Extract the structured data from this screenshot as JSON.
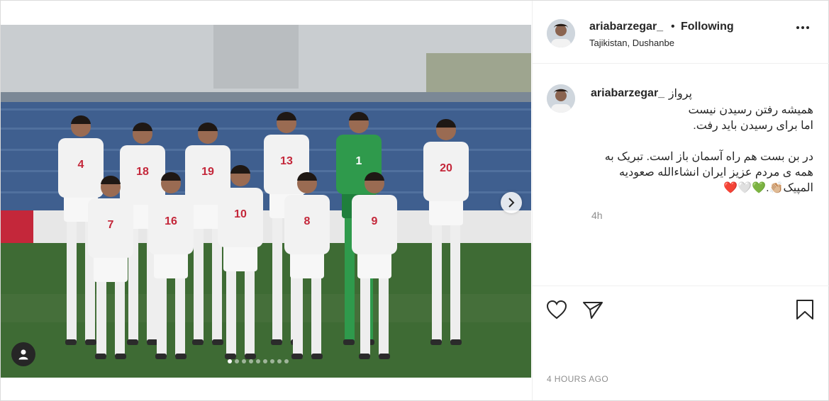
{
  "post": {
    "username": "ariabarzegar_",
    "separator": "•",
    "follow_label": "Following",
    "location": "Tajikistan, Dushanbe",
    "more_icon": "more-options-icon"
  },
  "caption": {
    "username": "ariabarzegar_",
    "lines": [
      "پرواز",
      "همیشه رفتن رسیدن نیست",
      "اما برای رسیدن باید رفت.",
      "در بن بست هم راه آسمان باز است. تبریک به همه ی مردم عزیز ایران انشاءالله صعودیه المپیک👏🏼.💚🤍❤️"
    ],
    "relative_time": "4h"
  },
  "actions": {
    "like_icon": "heart-icon",
    "share_icon": "paper-plane-icon",
    "save_icon": "bookmark-icon"
  },
  "timestamp": "4 HOURS AGO",
  "carousel": {
    "total_slides": 9,
    "active_slide": 1
  },
  "photo": {
    "jersey_numbers": [
      "4",
      "18",
      "19",
      "13",
      "1",
      "20",
      "7",
      "16",
      "10",
      "8",
      "9"
    ],
    "colors": {
      "sky": "#c9cdd0",
      "stand": "#3f5f8f",
      "pitch": "#3e6b34",
      "kit": "#f2f2f2",
      "keeper": "#2f9a4c",
      "number": "#c4273a"
    }
  }
}
